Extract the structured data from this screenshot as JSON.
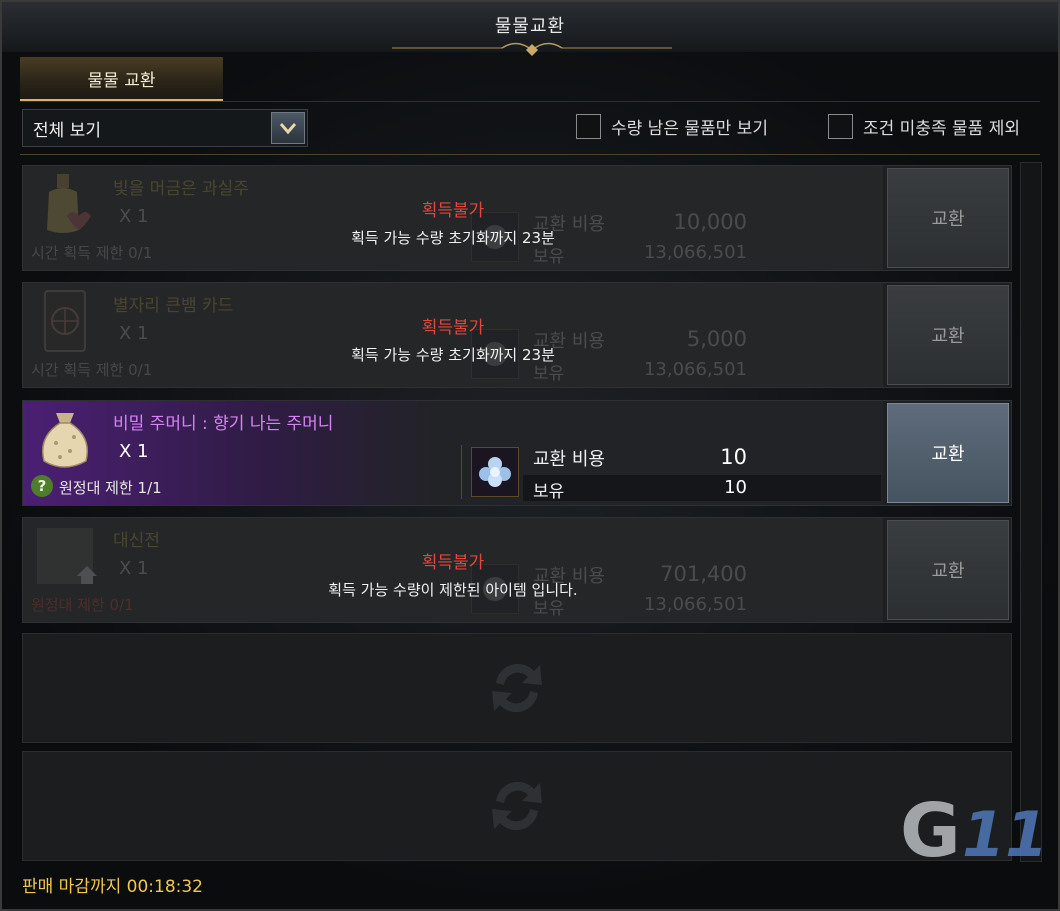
{
  "window": {
    "title": "물물교환"
  },
  "tabs": [
    {
      "label": "물물 교환",
      "active": true
    }
  ],
  "filter": {
    "selected": "전체 보기"
  },
  "checkboxes": {
    "remaining_only": {
      "label": "수량 남은 물품만 보기",
      "checked": false
    },
    "exclude_unmet": {
      "label": "조건 미충족 물품 제외",
      "checked": false
    }
  },
  "rows": [
    {
      "name": "빛을 머금은 과실주",
      "quantity": "X 1",
      "limit": "시간 획득 제한 0/1",
      "cost_label": "교환 비용",
      "cost_value": "10,000",
      "held_label": "보유",
      "held_value": "13,066,501",
      "unavailable": "획득불가",
      "reason": "획득 가능 수량 초기화까지 23분",
      "button": "교환",
      "icon": "fruit-wine-icon"
    },
    {
      "name": "별자리 큰뱀 카드",
      "quantity": "X 1",
      "limit": "시간 획득 제한 0/1",
      "cost_label": "교환 비용",
      "cost_value": "5,000",
      "held_label": "보유",
      "held_value": "13,066,501",
      "unavailable": "획득불가",
      "reason": "획득 가능 수량 초기화까지 23분",
      "button": "교환",
      "icon": "card-icon"
    },
    {
      "name": "비밀 주머니 : 향기 나는 주머니",
      "quantity": "X 1",
      "limit": "원정대 제한 1/1",
      "help": "?",
      "cost_label": "교환 비용",
      "cost_value": "10",
      "held_label": "보유",
      "held_value": "10",
      "button": "교환",
      "icon": "pouch-icon"
    },
    {
      "name": "대신전",
      "quantity": "X 1",
      "limit": "원정대 제한 0/1",
      "cost_label": "교환 비용",
      "cost_value": "701,400",
      "held_label": "보유",
      "held_value": "13,066,501",
      "unavailable": "획득불가",
      "reason": "획득 가능 수량이 제한된 아이템 입니다.",
      "button": "교환",
      "icon": "temple-icon"
    }
  ],
  "footer": {
    "sale_deadline": "판매 마감까지 00:18:32"
  },
  "watermark": "G11",
  "colors": {
    "accent_gold": "#d8b46a",
    "unavailable_red": "#e2473c",
    "epic_purple": "#d782f5",
    "deadline_yellow": "#f2c84b",
    "active_button": "#5e6c7b"
  }
}
